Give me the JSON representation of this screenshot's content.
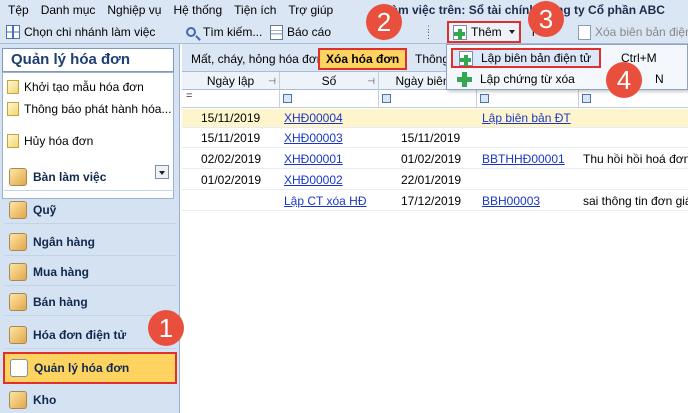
{
  "menubar": {
    "items": [
      "Tệp",
      "Danh mục",
      "Nghiệp vụ",
      "Hệ thống",
      "Tiện ích",
      "Trợ giúp"
    ],
    "workspace": "làm việc trên: Sổ tài chính Công ty Cổ phần ABC"
  },
  "toolbar": {
    "branch": "Chọn chi nhánh làm việc",
    "search": "Tìm kiếm...",
    "report": "Báo cáo",
    "add": "Thêm",
    "tich": "i",
    "delete_report": "Xóa biên bản điện"
  },
  "sidebar": {
    "title": "Quản lý hóa đơn",
    "links": [
      "Khởi tạo mẫu hóa đơn",
      "Thông báo phát hành hóa...",
      "Hủy hóa đơn"
    ],
    "modules": [
      "Bàn làm việc",
      "Quỹ",
      "Ngân hàng",
      "Mua hàng",
      "Bán hàng",
      "Hóa đơn điện tử",
      "Quản lý hóa đơn",
      "Kho"
    ]
  },
  "tabs": [
    "Mất, cháy, hỏng hóa đơn",
    "Xóa hóa đơn",
    "Thông"
  ],
  "grid": {
    "headers": [
      "Ngày lập",
      "Số",
      "Ngày biên b",
      "",
      ""
    ],
    "filter_eq": "=",
    "rows": [
      {
        "date": "15/11/2019",
        "num": "XHĐ00004",
        "bdate": "",
        "report": "Lập biên bản ĐT",
        "reason": ""
      },
      {
        "date": "15/11/2019",
        "num": "XHĐ00003",
        "bdate": "15/11/2019",
        "report": "",
        "reason": ""
      },
      {
        "date": "02/02/2019",
        "num": "XHĐ00001",
        "bdate": "01/02/2019",
        "report": "BBTHHĐ00001",
        "reason": "Thu hồi hồi hoá đơn c"
      },
      {
        "date": "01/02/2019",
        "num": "XHĐ00002",
        "bdate": "22/01/2019",
        "report": "",
        "reason": ""
      },
      {
        "date": "",
        "num": "Lập CT xóa HĐ",
        "bdate": "17/12/2019",
        "report": "BBH00003",
        "reason": "sai thông tin đơn giá"
      }
    ]
  },
  "dropdown": {
    "items": [
      {
        "label": "Lập biên bản điện tử",
        "shortcut": "Ctrl+M"
      },
      {
        "label": "Lập chứng từ xóa",
        "shortcut": "N"
      }
    ]
  },
  "badges": [
    "1",
    "2",
    "3",
    "4"
  ],
  "colors": {
    "accent_red": "#e0302b",
    "highlight": "#ffd35f",
    "badge": "#e84f3c",
    "link": "#1a37c9"
  }
}
